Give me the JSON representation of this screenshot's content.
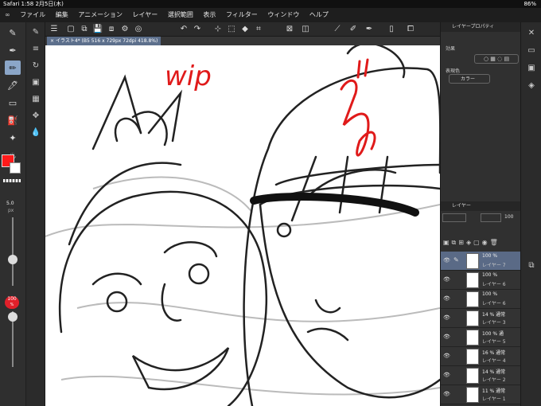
{
  "status": {
    "left": "Safari  1:58  2月5日(木)",
    "right": "86%"
  },
  "menu": [
    "ファイル",
    "編集",
    "アニメーション",
    "レイヤー",
    "選択範囲",
    "表示",
    "フィルター",
    "ウィンドウ",
    "ヘルプ"
  ],
  "tab": {
    "title": "イラスト4* (B5 516 x 729px 72dpi 418.8%)"
  },
  "left": {
    "brush_size": "5.0",
    "brush_unit": "px",
    "opacity": "100",
    "opacity_unit": "%"
  },
  "props": {
    "title": "レイヤープロパティ",
    "effect_label": "効果",
    "color_label": "表現色",
    "color_value": "カラー"
  },
  "layers": {
    "title": "レイヤー",
    "opacity": "100",
    "items": [
      {
        "pct": "100 %",
        "name": "レイヤー 7",
        "selected": true
      },
      {
        "pct": "100 %",
        "name": "レイヤー 6",
        "selected": false
      },
      {
        "pct": "100 %",
        "name": "レイヤー 6",
        "selected": false
      },
      {
        "pct": "14 % 通常",
        "name": "レイヤー 3",
        "selected": false
      },
      {
        "pct": "100 % 通",
        "name": "レイヤー 5",
        "selected": false
      },
      {
        "pct": "16 % 通常",
        "name": "レイヤー 4",
        "selected": false
      },
      {
        "pct": "14 % 通常",
        "name": "レイヤー 2",
        "selected": false
      },
      {
        "pct": "11 % 通常",
        "name": "レイヤー 1",
        "selected": false
      }
    ]
  },
  "canvas_text": {
    "wip": "wip"
  },
  "colors": {
    "main": "#ff1a1a",
    "selection": "#5a6a86"
  }
}
